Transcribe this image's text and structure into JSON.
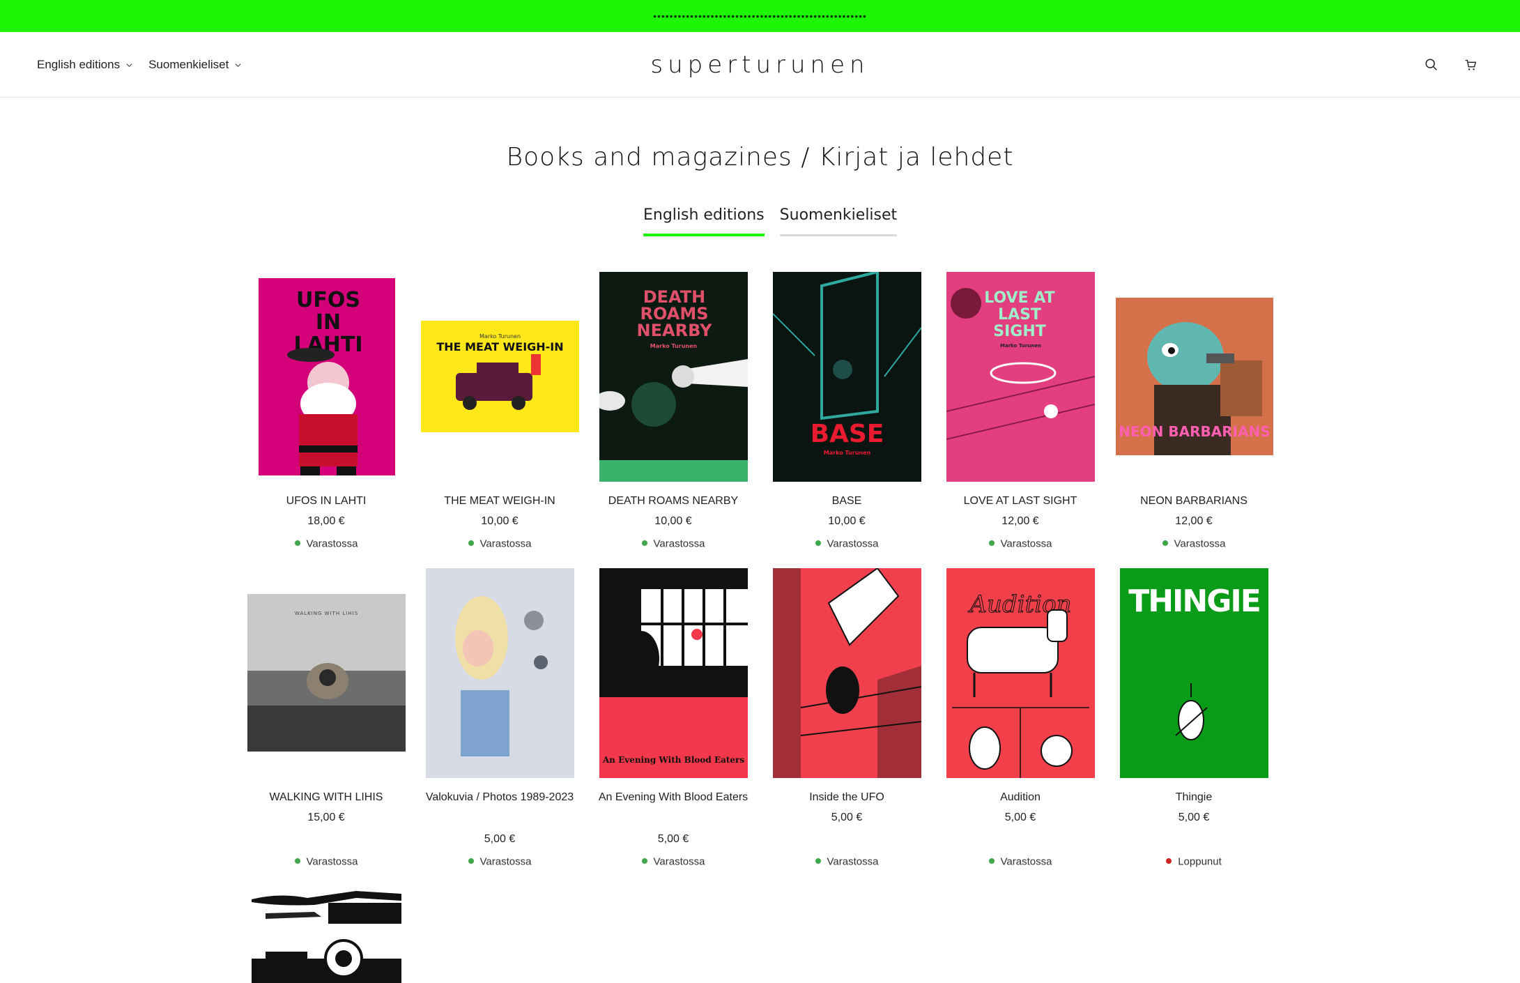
{
  "announcement": "••••••••••••••••••••••••••••••••••••••••••••••••••••",
  "header": {
    "logo": "superturunen",
    "nav_left": [
      "English editions",
      "Suomenkieliset"
    ]
  },
  "page_title": "Books and magazines / Kirjat ja lehdet",
  "tabs": [
    "English editions",
    "Suomenkieliset"
  ],
  "colors": {
    "accent": "#1ef704",
    "in_stock": "#3ea84a",
    "sold_out": "#d32222"
  },
  "products": [
    {
      "title": "UFOS IN LAHTI",
      "price": "18,00 €",
      "status": "Varastossa",
      "cover_text": "UFOS IN LAHTI"
    },
    {
      "title": "THE MEAT WEIGH-IN",
      "price": "10,00 €",
      "status": "Varastossa",
      "cover_text": "THE MEAT WEIGH-IN",
      "cover_sub": "Marko Turunen"
    },
    {
      "title": "DEATH ROAMS NEARBY",
      "price": "10,00 €",
      "status": "Varastossa",
      "cover_text": "DEATH ROAMS NEARBY",
      "cover_sub": "Marko Turunen"
    },
    {
      "title": "BASE",
      "price": "10,00 €",
      "status": "Varastossa",
      "cover_text": "BASE",
      "cover_sub": "Marko Turunen"
    },
    {
      "title": "LOVE AT LAST SIGHT",
      "price": "12,00 €",
      "status": "Varastossa",
      "cover_text": "LOVE AT LAST SIGHT",
      "cover_sub": "Marko Turunen"
    },
    {
      "title": "NEON BARBARIANS",
      "price": "12,00 €",
      "status": "Varastossa",
      "cover_text": "NEON BARBARIANS"
    },
    {
      "title": "WALKING WITH LIHIS",
      "price": "15,00 €",
      "status": "Varastossa",
      "cover_text": "WALKING WITH LIHIS"
    },
    {
      "title": "Valokuvia / Photos 1989-2023",
      "price": "5,00 €",
      "status": "Varastossa"
    },
    {
      "title": "An Evening With Blood Eaters",
      "price": "5,00 €",
      "status": "Varastossa",
      "cover_text": "An Evening With Blood Eaters"
    },
    {
      "title": "Inside the UFO",
      "price": "5,00 €",
      "status": "Varastossa"
    },
    {
      "title": "Audition",
      "price": "5,00 €",
      "status": "Varastossa",
      "cover_text": "Audition"
    },
    {
      "title": "Thingie",
      "price": "5,00 €",
      "status": "Loppunut",
      "cover_text": "THINGIE"
    }
  ]
}
